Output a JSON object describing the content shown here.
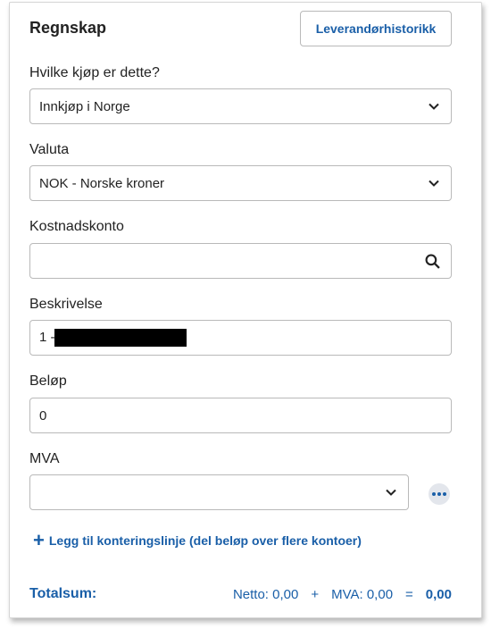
{
  "header": {
    "title": "Regnskap",
    "history_button": "Leverandørhistorikk"
  },
  "purchase_type": {
    "label": "Hvilke kjøp er dette?",
    "value": "Innkjøp i Norge"
  },
  "currency": {
    "label": "Valuta",
    "value": "NOK - Norske kroner"
  },
  "cost_account": {
    "label": "Kostnadskonto",
    "value": ""
  },
  "description": {
    "label": "Beskrivelse",
    "value_prefix": "1 -"
  },
  "amount": {
    "label": "Beløp",
    "value": "0"
  },
  "vat": {
    "label": "MVA",
    "value": ""
  },
  "add_line": {
    "label": "Legg til konteringslinje (del beløp over flere kontoer)"
  },
  "totals": {
    "label": "Totalsum:",
    "netto": "Netto: 0,00",
    "plus": "+",
    "mva": "MVA: 0,00",
    "equals": "=",
    "sum": "0,00"
  },
  "colors": {
    "accent": "#1a5fa8",
    "border": "#b9b9b9"
  }
}
